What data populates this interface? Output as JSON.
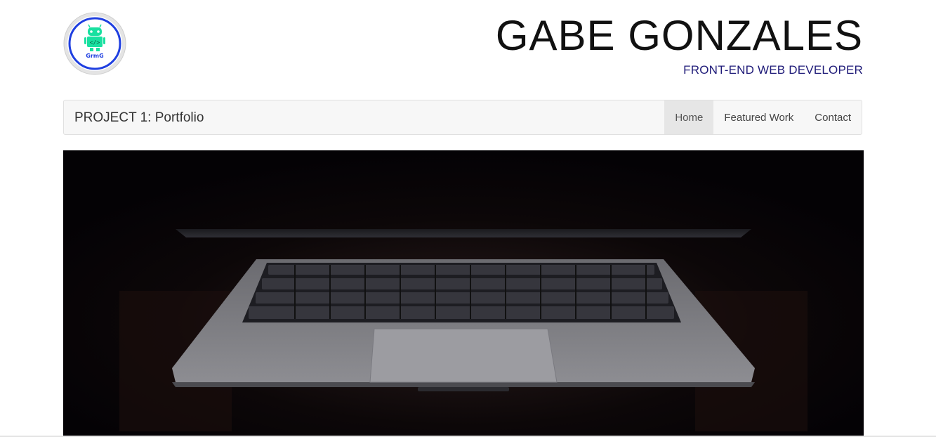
{
  "header": {
    "title": "GABE GONZALES",
    "subtitle": "FRONT-END WEB DEVELOPER",
    "logo_text": "GrmG"
  },
  "navbar": {
    "brand": "PROJECT 1: Portfolio",
    "links": [
      {
        "label": "Home",
        "active": true
      },
      {
        "label": "Featured Work",
        "active": false
      },
      {
        "label": "Contact",
        "active": false
      }
    ]
  },
  "hero": {
    "image": "laptop-keyboard-photo"
  },
  "colors": {
    "subtitle": "#1e1a78",
    "navbar_bg": "#f7f7f7",
    "logo_ring": "#1f3fe0",
    "logo_fill": "#19e0a0"
  }
}
